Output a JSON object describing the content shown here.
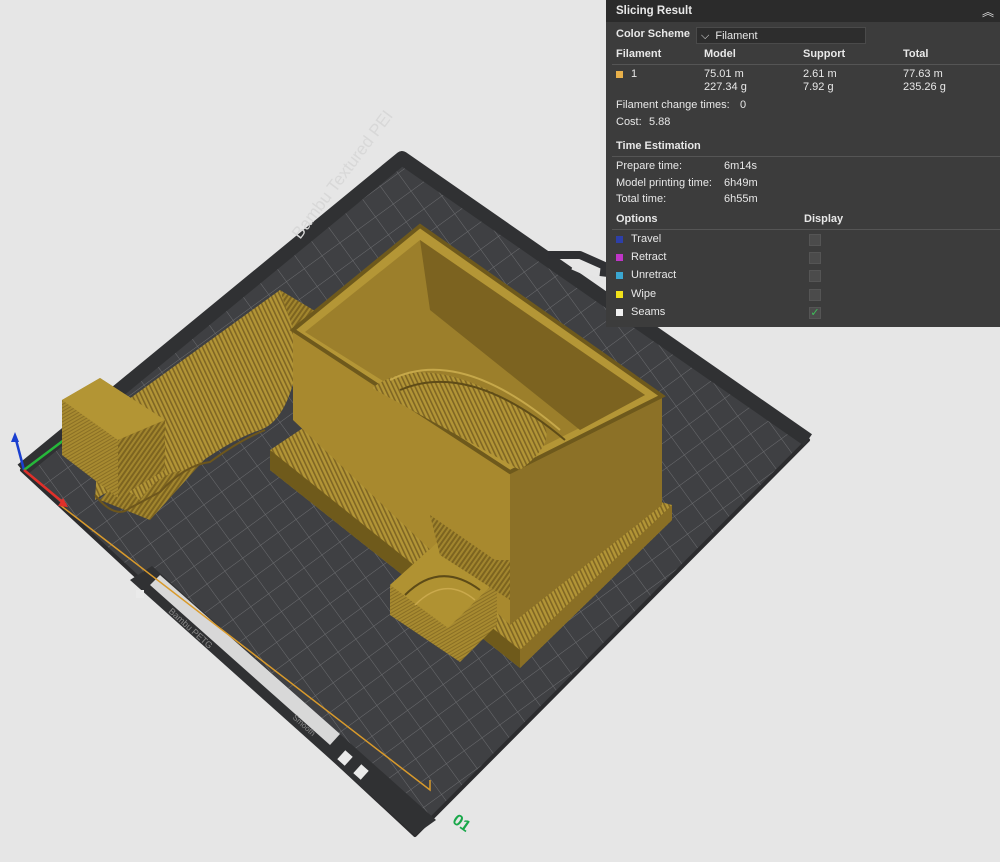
{
  "viewport": {
    "plate_name": "Bambu Textured PEI",
    "plate_number": "01",
    "plate_filament_label": "Bambu PETG",
    "plate_type_label": "Smooth"
  },
  "panel": {
    "title": "Slicing Result",
    "color_scheme_label": "Color Scheme",
    "color_scheme_value": "Filament",
    "columns": [
      "Filament",
      "Model",
      "Support",
      "Total"
    ],
    "filament_row": {
      "id": "1",
      "color": "#e8b04a",
      "model_length": "75.01 m",
      "model_weight": "227.34 g",
      "support_length": "2.61 m",
      "support_weight": "7.92 g",
      "total_length": "77.63 m",
      "total_weight": "235.26 g"
    },
    "filament_change_label": "Filament change times:",
    "filament_change_value": "0",
    "cost_label": "Cost:",
    "cost_value": "5.88",
    "time_estimation_label": "Time Estimation",
    "prepare_label": "Prepare time:",
    "prepare_value": "6m14s",
    "model_print_label": "Model printing time:",
    "model_print_value": "6h49m",
    "total_label": "Total time:",
    "total_value": "6h55m",
    "options_label": "Options",
    "display_label": "Display",
    "options": [
      {
        "label": "Travel",
        "color": "#2d3fa8",
        "checked": false
      },
      {
        "label": "Retract",
        "color": "#c035c8",
        "checked": false
      },
      {
        "label": "Unretract",
        "color": "#3aa6d0",
        "checked": false
      },
      {
        "label": "Wipe",
        "color": "#f2e21a",
        "checked": false
      },
      {
        "label": "Seams",
        "color": "#f0f0f0",
        "checked": true
      }
    ]
  }
}
